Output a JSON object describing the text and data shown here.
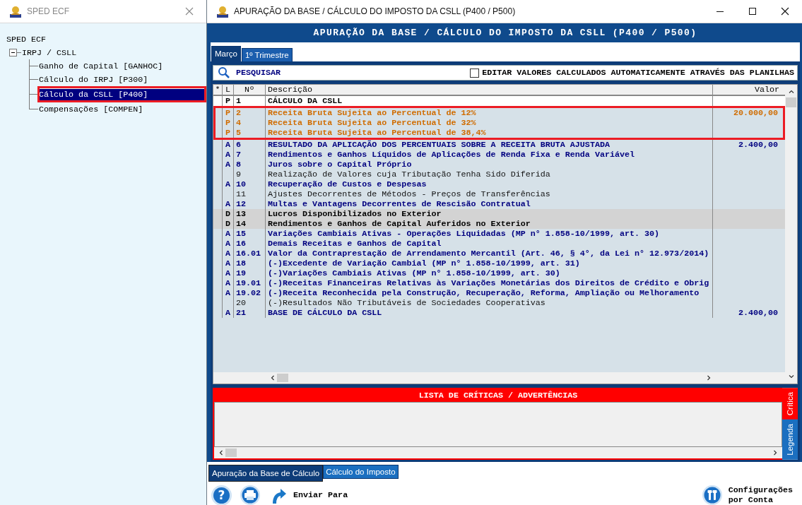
{
  "tree_window": {
    "title": "SPED ECF",
    "tree": [
      {
        "label": "SPED ECF",
        "children": [
          {
            "label": "IRPJ / CSLL",
            "expanded": true,
            "selected": false,
            "children": [
              {
                "label": "Ganho de Capital [GANHOC]",
                "selected": false
              },
              {
                "label": "Cálculo do IRPJ [P300]",
                "selected": false
              },
              {
                "label": "Cálculo da CSLL [P400]",
                "selected": true,
                "highlighted": true
              },
              {
                "label": "Compensações [COMPEN]",
                "selected": false
              }
            ]
          }
        ]
      }
    ]
  },
  "main_window": {
    "title": "APURAÇÃO DA BASE / CÁLCULO DO IMPOSTO DA CSLL (P400 / P500)",
    "header": "APURAÇÃO DA BASE / CÁLCULO DO IMPOSTO DA CSLL (P400 / P500)",
    "tabs": [
      {
        "label": "Março",
        "selected": true
      },
      {
        "label": "1º Trimestre",
        "selected": false
      }
    ],
    "search": {
      "label": "PESQUISAR"
    },
    "edit_option": {
      "label": "EDITAR VALORES CALCULADOS AUTOMATICAMENTE ATRAVÉS DAS PLANILHAS",
      "checked": false
    },
    "table": {
      "columns": [
        "*",
        "L",
        "Nº",
        "Descrição",
        "Valor"
      ],
      "rows": [
        {
          "kind": "titulo",
          "flag": "P",
          "number": "1",
          "description": "CÁLCULO DA CSLL",
          "highlighted": false
        },
        {
          "kind": "parametro",
          "flag": "P",
          "number": "2",
          "description": "Receita Bruta Sujeita ao Percentual de 12%",
          "value": "20.000,00",
          "highlighted": true
        },
        {
          "kind": "parametro",
          "flag": "P",
          "number": "4",
          "description": "Receita Bruta Sujeita ao Percentual de 32%",
          "highlighted": true
        },
        {
          "kind": "parametro",
          "flag": "P",
          "number": "5",
          "description": "Receita Bruta Sujeita ao Percentual de 38,4%",
          "highlighted": true
        },
        {
          "kind": "automatico",
          "flag": "A",
          "number": "6",
          "description": "RESULTADO DA APLICAÇÃO DOS PERCENTUAIS SOBRE A RECEITA BRUTA AJUSTADA",
          "value": "2.400,00",
          "highlighted": false
        },
        {
          "kind": "automatico",
          "flag": "A",
          "number": "7",
          "description": "Rendimentos e Ganhos Líquidos de Aplicações de Renda Fixa e Renda Variável",
          "highlighted": false
        },
        {
          "kind": "automatico",
          "flag": "A",
          "number": "8",
          "description": "Juros sobre o Capital Próprio",
          "highlighted": false
        },
        {
          "kind": "editavel",
          "number": "9",
          "description": "Realização de Valores cuja Tributação Tenha Sido Diferida",
          "highlighted": false
        },
        {
          "kind": "automatico",
          "flag": "A",
          "number": "10",
          "description": "Recuperação de Custos e Despesas",
          "highlighted": false
        },
        {
          "kind": "editavel",
          "number": "11",
          "description": "Ajustes Decorrentes de Métodos - Preços de Transferências",
          "highlighted": false
        },
        {
          "kind": "automatico",
          "flag": "A",
          "number": "12",
          "description": "Multas e Vantagens Decorrentes de Rescisão Contratual",
          "highlighted": false
        },
        {
          "kind": "desativado",
          "flag": "D",
          "number": "13",
          "description": "Lucros Disponibilizados no Exterior",
          "highlighted": false
        },
        {
          "kind": "desativado",
          "flag": "D",
          "number": "14",
          "description": "Rendimentos e Ganhos de Capital Auferidos no Exterior",
          "highlighted": false
        },
        {
          "kind": "automatico",
          "flag": "A",
          "number": "15",
          "description": "Variações Cambiais Ativas - Operações Liquidadas (MP n° 1.858-10/1999, art. 30)",
          "highlighted": false
        },
        {
          "kind": "automatico",
          "flag": "A",
          "number": "16",
          "description": "Demais Receitas e Ganhos de Capital",
          "highlighted": false
        },
        {
          "kind": "automatico",
          "flag": "A",
          "number": "16.01",
          "description": "Valor da Contraprestação de Arrendamento Mercantil (Art. 46, § 4°, da Lei n° 12.973/2014)",
          "highlighted": false
        },
        {
          "kind": "automatico",
          "flag": "A",
          "number": "18",
          "description": "(-)Excedente de Variação Cambial (MP n° 1.858-10/1999, art. 31)",
          "highlighted": false
        },
        {
          "kind": "automatico",
          "flag": "A",
          "number": "19",
          "description": "(-)Variações Cambiais Ativas (MP n° 1.858-10/1999, art. 30)",
          "highlighted": false
        },
        {
          "kind": "automatico",
          "flag": "A",
          "number": "19.01",
          "description": "(-)Receitas Financeiras Relativas às Variações Monetárias dos Direitos de Crédito e Obrig",
          "highlighted": false
        },
        {
          "kind": "automatico",
          "flag": "A",
          "number": "19.02",
          "description": "(-)Receita Reconhecida pela Construção, Recuperação, Reforma, Ampliação ou Melhoramento",
          "highlighted": false
        },
        {
          "kind": "editavel",
          "number": "20",
          "description": "(-)Resultados Não Tributáveis de Sociedades Cooperativas",
          "highlighted": false
        },
        {
          "kind": "automatico",
          "flag": "A",
          "number": "21",
          "description": "BASE DE CÁLCULO DA CSLL",
          "value": "2.400,00",
          "highlighted": false
        }
      ]
    },
    "critics": {
      "title": "LISTA DE CRÍTICAS / ADVERTÊNCIAS",
      "side_tabs": [
        {
          "label": "Crítica",
          "selected": true
        },
        {
          "label": "Legenda",
          "selected": false
        }
      ]
    },
    "bottom_tabs": [
      {
        "label": "Apuração da Base de Cálculo",
        "selected": true
      },
      {
        "label": "Cálculo do Imposto",
        "selected": false
      }
    ],
    "toolbar": [
      {
        "kind": "help",
        "label": "?"
      },
      {
        "kind": "print"
      },
      {
        "kind": "send",
        "label": "Enviar Para"
      },
      {
        "kind": "spacer"
      },
      {
        "kind": "settings",
        "label": "Configurações por Conta"
      }
    ]
  }
}
